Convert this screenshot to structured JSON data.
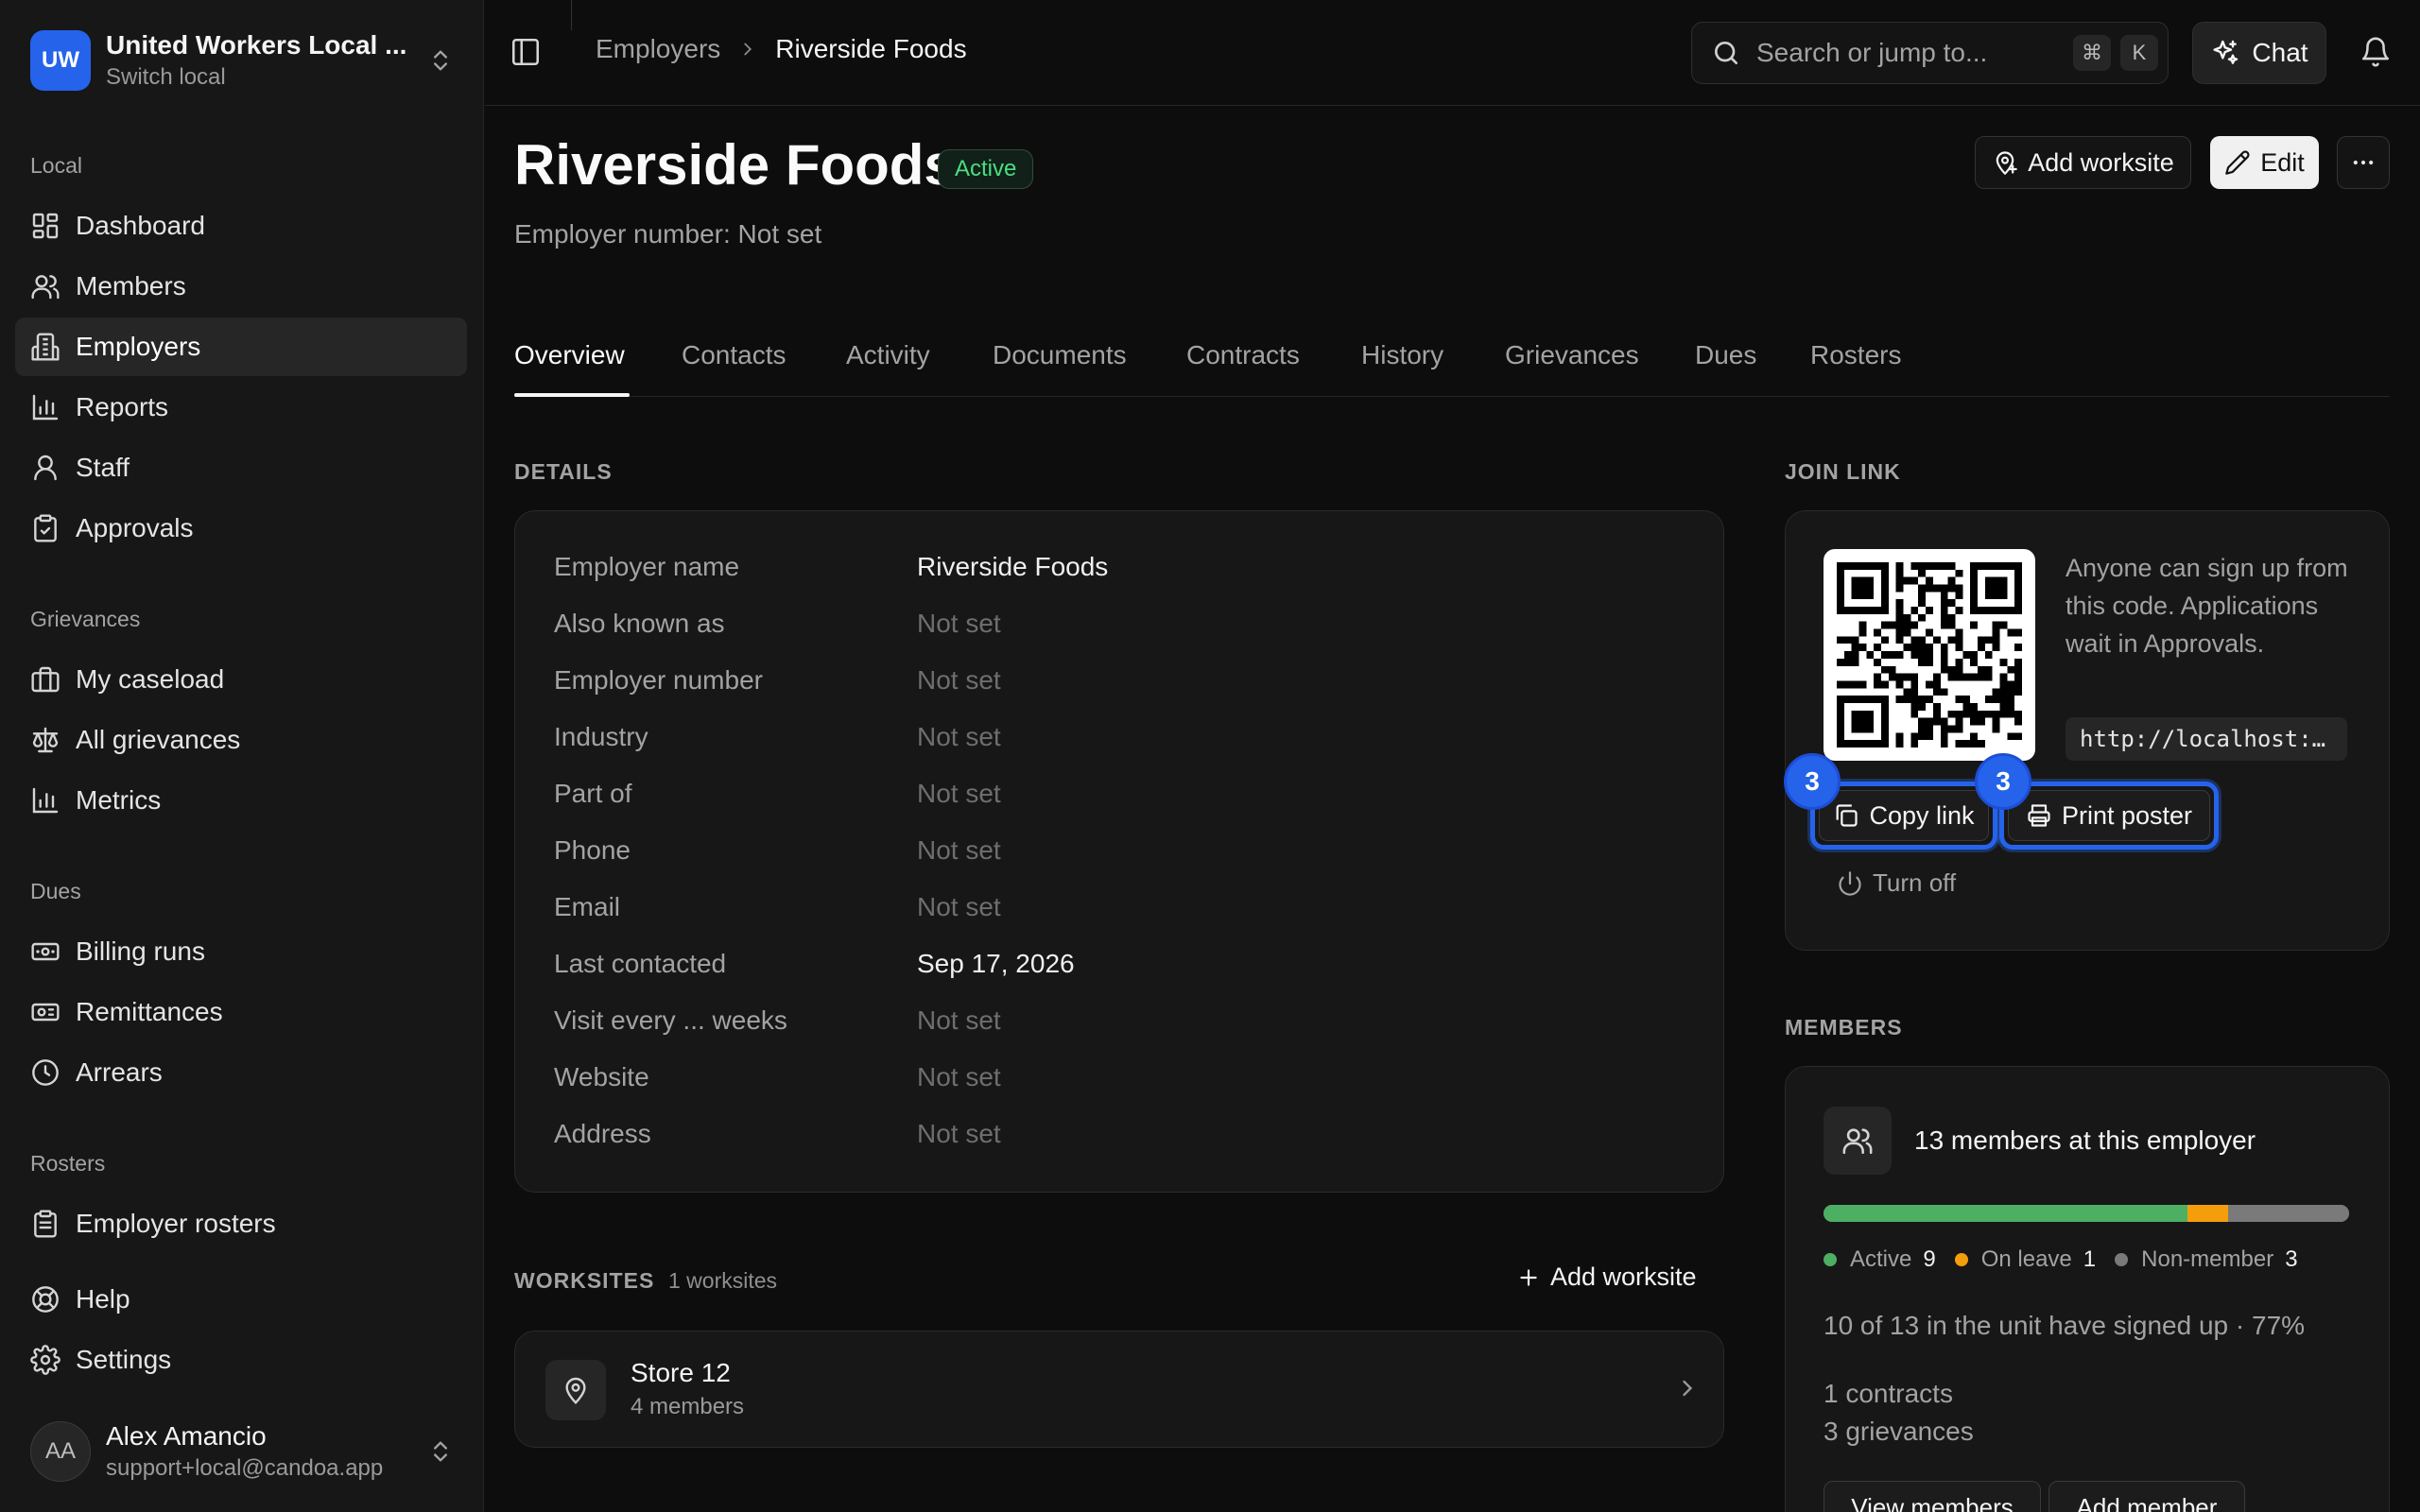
{
  "org": {
    "initials": "UW",
    "name": "United Workers Local ...",
    "sub": "Switch local"
  },
  "sidebar": {
    "sections": {
      "local": "Local",
      "grievances": "Grievances",
      "dues": "Dues",
      "rosters": "Rosters"
    },
    "items": {
      "dashboard": "Dashboard",
      "members": "Members",
      "employers": "Employers",
      "reports": "Reports",
      "staff": "Staff",
      "approvals": "Approvals",
      "my_caseload": "My caseload",
      "all_grievances": "All grievances",
      "metrics": "Metrics",
      "billing_runs": "Billing runs",
      "remittances": "Remittances",
      "arrears": "Arrears",
      "employer_rosters": "Employer rosters",
      "help": "Help",
      "settings": "Settings"
    },
    "active_item": "Employers"
  },
  "user": {
    "initials": "AA",
    "name": "Alex Amancio",
    "email": "support+local@candoa.app"
  },
  "topbar": {
    "breadcrumb_parent": "Employers",
    "breadcrumb_current": "Riverside Foods",
    "search_placeholder": "Search or jump to...",
    "kbd_cmd": "⌘",
    "kbd_k": "K",
    "chat_label": "Chat"
  },
  "header": {
    "title": "Riverside Foods",
    "status": "Active",
    "subtitle": "Employer number: Not set",
    "add_worksite_label": "Add worksite",
    "edit_label": "Edit"
  },
  "tabs": [
    "Overview",
    "Contacts",
    "Activity",
    "Documents",
    "Contracts",
    "History",
    "Grievances",
    "Dues",
    "Rosters"
  ],
  "details": {
    "label": "DETAILS",
    "rows": [
      {
        "label": "Employer name",
        "value": "Riverside Foods"
      },
      {
        "label": "Also known as",
        "value": "Not set"
      },
      {
        "label": "Employer number",
        "value": "Not set"
      },
      {
        "label": "Industry",
        "value": "Not set"
      },
      {
        "label": "Part of",
        "value": "Not set"
      },
      {
        "label": "Phone",
        "value": "Not set"
      },
      {
        "label": "Email",
        "value": "Not set"
      },
      {
        "label": "Last contacted",
        "value": "Sep 17, 2026"
      },
      {
        "label": "Visit every ... weeks",
        "value": "Not set"
      },
      {
        "label": "Website",
        "value": "Not set"
      },
      {
        "label": "Address",
        "value": "Not set"
      }
    ]
  },
  "worksites": {
    "label": "WORKSITES",
    "count": "1 worksites",
    "add_label": "Add worksite",
    "items": [
      {
        "name": "Store 12",
        "members": "4 members"
      }
    ]
  },
  "join_link": {
    "label": "JOIN LINK",
    "description": "Anyone can sign up from this code. Applications wait in Approvals.",
    "url": "http://localhost:…",
    "copy_label": "Copy link",
    "print_label": "Print poster",
    "turn_off_label": "Turn off",
    "badge_copy": "3",
    "badge_print": "3"
  },
  "members": {
    "label": "MEMBERS",
    "title": "13 members at this employer",
    "active_label": "Active",
    "active_count": "9",
    "leave_label": "On leave",
    "leave_count": "1",
    "non_label": "Non-member",
    "non_count": "3",
    "bar_fractions": {
      "active": 0.692,
      "leave": 0.077,
      "non": 0.231
    },
    "signed_up": "10 of 13 in the unit have signed up · 77%",
    "contracts": "1 contracts",
    "grievances": "3 grievances",
    "view_label": "View members",
    "add_label": "Add member"
  },
  "colors": {
    "accent": "#2563eb",
    "active": "#4caf63",
    "leave": "#f59e0b",
    "non_member": "#7a7a7a",
    "status_green": "#4ade80"
  }
}
